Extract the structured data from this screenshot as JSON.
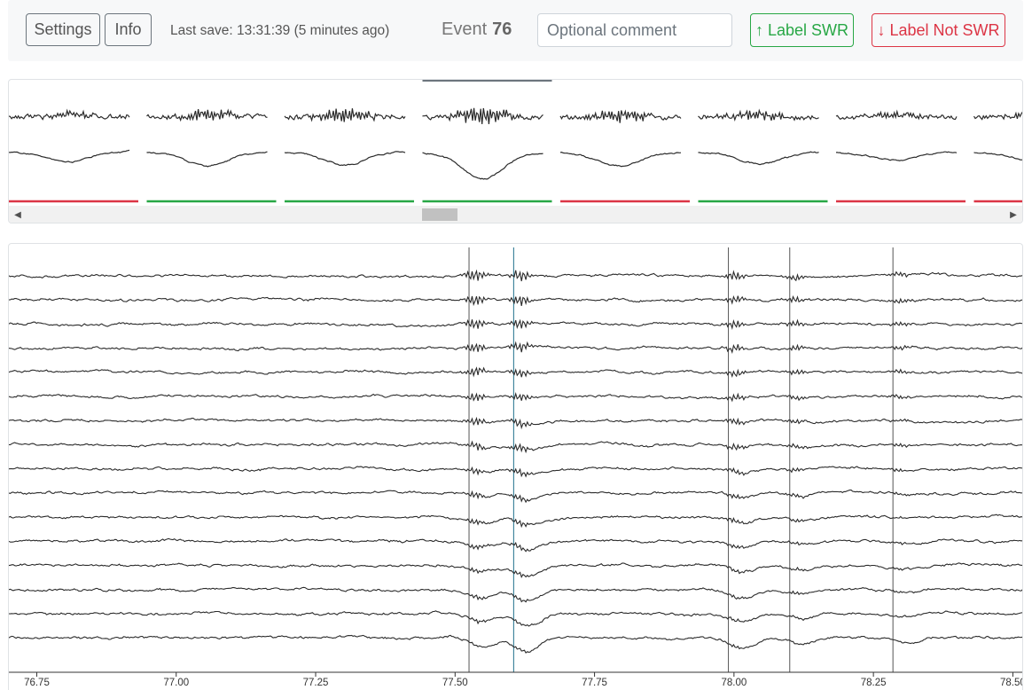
{
  "toolbar": {
    "settings_label": "Settings",
    "info_label": "Info",
    "last_save": "Last save: 13:31:39 (5 minutes ago)",
    "event_label": "Event",
    "event_number": "76",
    "comment_placeholder": "Optional comment",
    "comment_value": "",
    "label_swr": "↑ Label SWR",
    "label_not_swr": "↓ Label Not SWR"
  },
  "thumbnails": {
    "selected_index": 3,
    "labels": [
      "not-swr",
      "swr",
      "swr",
      "swr",
      "not-swr",
      "swr",
      "not-swr",
      "not-swr"
    ],
    "scroll_position": 0.42
  },
  "colors": {
    "swr": "#28a745",
    "not_swr": "#dc3545",
    "trace": "#2b2b2b",
    "event_marker": "#1f6f8b",
    "other_marker": "#555555"
  },
  "chart_data": {
    "type": "line",
    "channels": 16,
    "xlim": [
      76.7,
      78.52
    ],
    "xticks": [
      "76.75",
      "77.00",
      "77.25",
      "77.50",
      "77.75",
      "78.00",
      "78.25",
      "78.50"
    ],
    "xtick_values": [
      76.75,
      77.0,
      77.25,
      77.5,
      77.75,
      78.0,
      78.25,
      78.5
    ],
    "current_event_time": 77.605,
    "event_markers": [
      77.525,
      77.605,
      77.99,
      78.1,
      78.285
    ]
  }
}
